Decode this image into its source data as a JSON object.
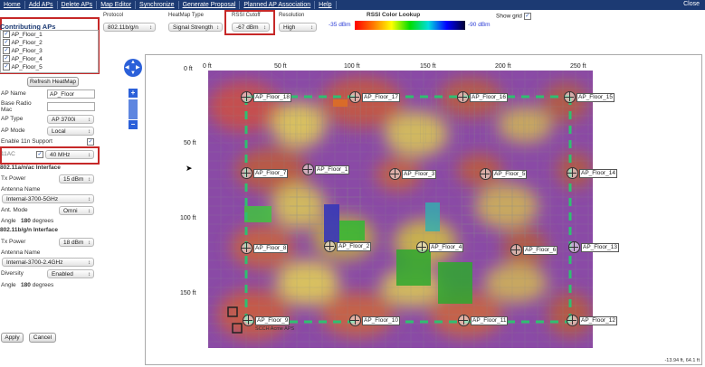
{
  "menu": [
    "Home",
    "Add APs",
    "Delete APs",
    "Map Editor",
    "Synchronize",
    "Generate Proposal",
    "Planned AP Association",
    "Help"
  ],
  "close_label": "Close",
  "controls": {
    "protocol": {
      "label": "Protocol",
      "value": "802.11b/g/n"
    },
    "heatmap_type": {
      "label": "HeatMap Type",
      "value": "Signal Strength"
    },
    "rssi_cutoff": {
      "label": "RSSI Cutoff",
      "value": "-67 dBm"
    },
    "resolution": {
      "label": "Resolution",
      "value": "High"
    }
  },
  "lookup": {
    "title": "RSSI Color Lookup",
    "min": "-35 dBm",
    "max": "-90 dBm"
  },
  "show_grid": {
    "label": "Show grid",
    "checked": true
  },
  "contributing": {
    "title": "Contributing APs",
    "items": [
      "AP_Floor_1",
      "AP_Floor_2",
      "AP_Floor_3",
      "AP_Floor_4",
      "AP_Floor_5"
    ]
  },
  "refresh_label": "Refresh HeatMap",
  "props": {
    "ap_name_label": "AP Name",
    "ap_name_value": "AP_Floor",
    "base_radio_label": "Base Radio Mac",
    "ap_type_label": "AP Type",
    "ap_type_value": "AP 3700i",
    "ap_mode_label": "AP Mode",
    "ap_mode_value": "Local",
    "enable_11n_label": "Enable 11n Support",
    "ac_label": "11AC",
    "ac_value": "40 MHz",
    "section_5g": "802.11a/n/ac Interface",
    "tx5_label": "Tx Power",
    "tx5_value": "15 dBm",
    "ant5_label": "Antenna Name",
    "ant5_value": "Internal-3700-5GHz",
    "antmode_label": "Ant. Mode",
    "antmode_value": "Omni",
    "angle5_label": "Angle",
    "angle5_value": "180",
    "angle5_unit": "degrees",
    "section_24g": "802.11b/g/n Interface",
    "tx24_label": "Tx Power",
    "tx24_value": "18 dBm",
    "ant24_label": "Antenna Name",
    "ant24_value": "Internal-3700-2.4GHz",
    "diversity_label": "Diversity",
    "diversity_value": "Enabled",
    "angle24_label": "Angle",
    "angle24_value": "180",
    "angle24_unit": "degrees"
  },
  "apply_label": "Apply",
  "cancel_label": "Cancel",
  "axes": {
    "x": [
      "0 ft",
      "50 ft",
      "100 ft",
      "150 ft",
      "200 ft",
      "250 ft"
    ],
    "y": [
      "0 ft",
      "50 ft",
      "100 ft",
      "150 ft"
    ]
  },
  "aps": [
    "AP_Floor_18",
    "AP_Floor_17",
    "AP_Floor_16",
    "AP_Floor_15",
    "AP_Floor_7",
    "AP_Floor_1",
    "AP_Floor_3",
    "AP_Floor_5",
    "AP_Floor_14",
    "AP_Floor_8",
    "AP_Floor_2",
    "AP_Floor_4",
    "AP_Floor_6",
    "AP_Floor_13",
    "AP_Floor_9",
    "AP_Floor_10",
    "AP_Floor_11",
    "AP_Floor_12"
  ],
  "plan_caption": "SCCH Acme APS",
  "coordinates": "-13.94 ft, 64.1 ft",
  "colors": {
    "menu_bar": "#1c3a73",
    "highlight_box": "#c62828",
    "accent_link": "#2a3bd6",
    "route": "#2fbf71"
  }
}
